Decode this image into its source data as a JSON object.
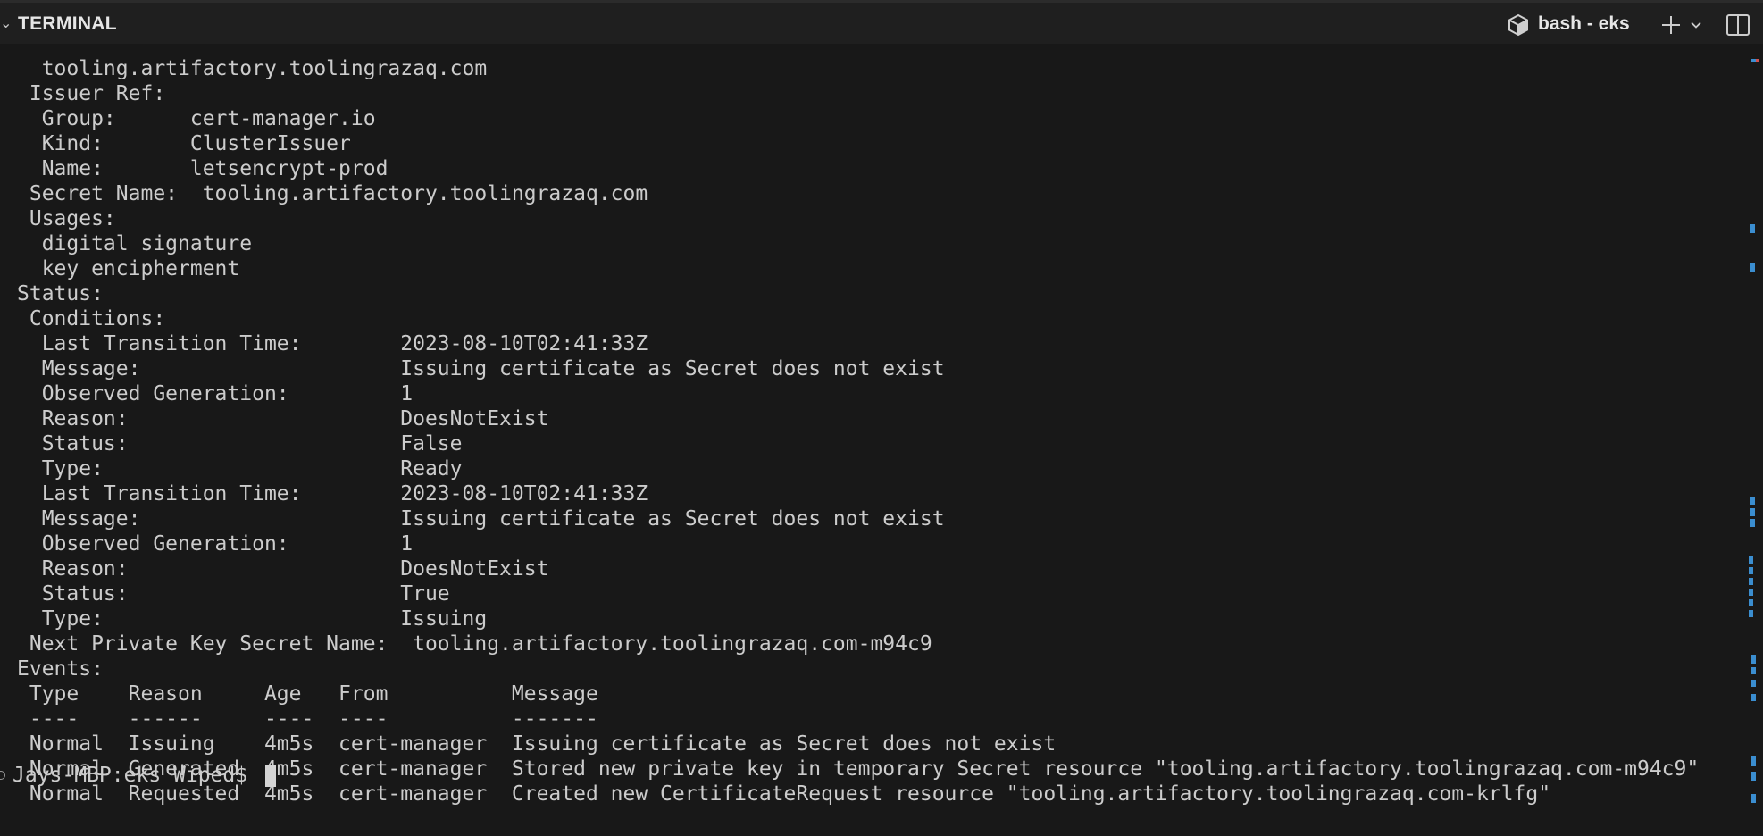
{
  "panel": {
    "title": "TERMINAL",
    "collapse_glyph": "⌄",
    "terminal_name": "bash - eks",
    "terminal_icon": "terminal-profile-icon",
    "buttons": [
      "new-terminal-icon",
      "dropdown-chevron-icon",
      "split-panel-icon"
    ]
  },
  "output_lines": [
    "  tooling.artifactory.toolingrazaq.com",
    " Issuer Ref:",
    "  Group:      cert-manager.io",
    "  Kind:       ClusterIssuer",
    "  Name:       letsencrypt-prod",
    " Secret Name:  tooling.artifactory.toolingrazaq.com",
    " Usages:",
    "  digital signature",
    "  key encipherment",
    "Status:",
    " Conditions:",
    "  Last Transition Time:        2023-08-10T02:41:33Z",
    "  Message:                     Issuing certificate as Secret does not exist",
    "  Observed Generation:         1",
    "  Reason:                      DoesNotExist",
    "  Status:                      False",
    "  Type:                        Ready",
    "  Last Transition Time:        2023-08-10T02:41:33Z",
    "  Message:                     Issuing certificate as Secret does not exist",
    "  Observed Generation:         1",
    "  Reason:                      DoesNotExist",
    "  Status:                      True",
    "  Type:                        Issuing",
    " Next Private Key Secret Name:  tooling.artifactory.toolingrazaq.com-m94c9",
    "Events:",
    " Type    Reason     Age   From          Message",
    " ----    ------     ----  ----          -------",
    " Normal  Issuing    4m5s  cert-manager  Issuing certificate as Secret does not exist",
    " Normal  Generated  4m5s  cert-manager  Stored new private key in temporary Secret resource \"tooling.artifactory.toolingrazaq.com-m94c9\"",
    " Normal  Requested  4m5s  cert-manager  Created new CertificateRequest resource \"tooling.artifactory.toolingrazaq.com-krlfg\""
  ],
  "prompt": {
    "text": "Jays-MBP:eks Wiped$ "
  },
  "colors": {
    "background": "#181818",
    "header_background": "#1f1f1f",
    "text": "#cccccc",
    "scroll_marker": "#3b8ed0",
    "error_marker": "#d05050"
  }
}
